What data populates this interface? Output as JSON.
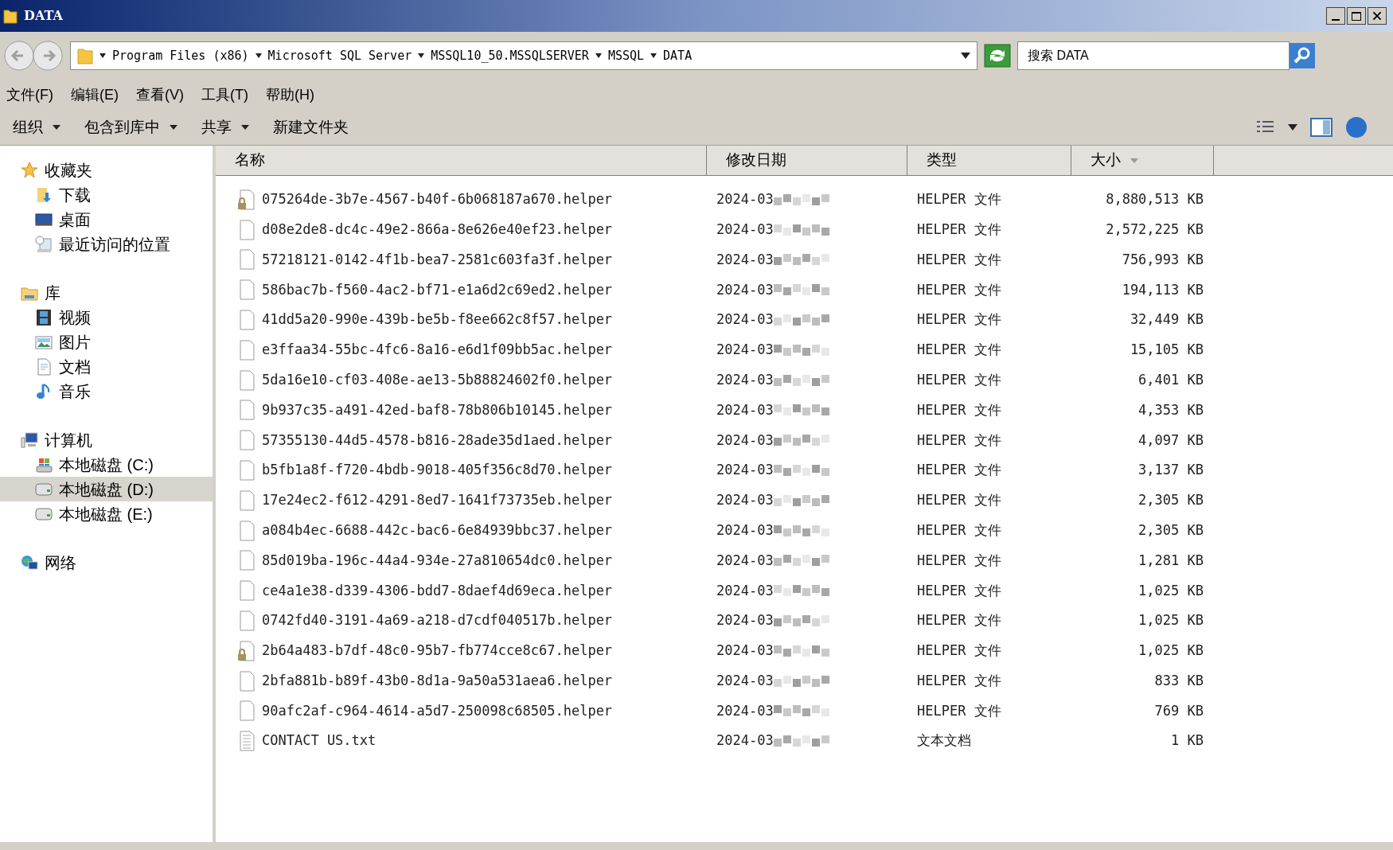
{
  "window": {
    "title": "DATA"
  },
  "address": {
    "segments": [
      "Program Files (x86)",
      "Microsoft SQL Server",
      "MSSQL10_50.MSSQLSERVER",
      "MSSQL",
      "DATA"
    ]
  },
  "search": {
    "placeholder": "搜索 DATA"
  },
  "menu": [
    "文件(F)",
    "编辑(E)",
    "查看(V)",
    "工具(T)",
    "帮助(H)"
  ],
  "toolbar": [
    {
      "label": "组织",
      "dropdown": true
    },
    {
      "label": "包含到库中",
      "dropdown": true
    },
    {
      "label": "共享",
      "dropdown": true
    },
    {
      "label": "新建文件夹",
      "dropdown": false
    }
  ],
  "sidebar": [
    {
      "label": "收藏夹",
      "children": [
        {
          "label": "下载",
          "selected": false
        },
        {
          "label": "桌面",
          "selected": false
        },
        {
          "label": "最近访问的位置",
          "selected": false
        }
      ]
    },
    {
      "label": "库",
      "children": [
        {
          "label": "视频",
          "selected": false
        },
        {
          "label": "图片",
          "selected": false
        },
        {
          "label": "文档",
          "selected": false
        },
        {
          "label": "音乐",
          "selected": false
        }
      ]
    },
    {
      "label": "计算机",
      "children": [
        {
          "label": "本地磁盘 (C:)",
          "selected": false
        },
        {
          "label": "本地磁盘 (D:)",
          "selected": true
        },
        {
          "label": "本地磁盘 (E:)",
          "selected": false
        }
      ]
    },
    {
      "label": "网络"
    }
  ],
  "columns": [
    {
      "label": "名称",
      "sorted": false
    },
    {
      "label": "修改日期",
      "sorted": false
    },
    {
      "label": "类型",
      "sorted": false
    },
    {
      "label": "大小",
      "sorted": true
    }
  ],
  "files": [
    {
      "name": "075264de-3b7e-4567-b40f-6b068187a670.helper",
      "kind": "file",
      "locked": true,
      "date": "2024-03",
      "type": "HELPER 文件",
      "size": "8,880,513 KB"
    },
    {
      "name": "d08e2de8-dc4c-49e2-866a-8e626e40ef23.helper",
      "kind": "file",
      "locked": false,
      "date": "2024-03",
      "type": "HELPER 文件",
      "size": "2,572,225 KB"
    },
    {
      "name": "57218121-0142-4f1b-bea7-2581c603fa3f.helper",
      "kind": "file",
      "locked": false,
      "date": "2024-03",
      "type": "HELPER 文件",
      "size": "756,993 KB"
    },
    {
      "name": "586bac7b-f560-4ac2-bf71-e1a6d2c69ed2.helper",
      "kind": "file",
      "locked": false,
      "date": "2024-03",
      "type": "HELPER 文件",
      "size": "194,113 KB"
    },
    {
      "name": "41dd5a20-990e-439b-be5b-f8ee662c8f57.helper",
      "kind": "file",
      "locked": false,
      "date": "2024-03",
      "type": "HELPER 文件",
      "size": "32,449 KB"
    },
    {
      "name": "e3ffaa34-55bc-4fc6-8a16-e6d1f09bb5ac.helper",
      "kind": "file",
      "locked": false,
      "date": "2024-03",
      "type": "HELPER 文件",
      "size": "15,105 KB"
    },
    {
      "name": "5da16e10-cf03-408e-ae13-5b88824602f0.helper",
      "kind": "file",
      "locked": false,
      "date": "2024-03",
      "type": "HELPER 文件",
      "size": "6,401 KB"
    },
    {
      "name": "9b937c35-a491-42ed-baf8-78b806b10145.helper",
      "kind": "file",
      "locked": false,
      "date": "2024-03",
      "type": "HELPER 文件",
      "size": "4,353 KB"
    },
    {
      "name": "57355130-44d5-4578-b816-28ade35d1aed.helper",
      "kind": "file",
      "locked": false,
      "date": "2024-03",
      "type": "HELPER 文件",
      "size": "4,097 KB"
    },
    {
      "name": "b5fb1a8f-f720-4bdb-9018-405f356c8d70.helper",
      "kind": "file",
      "locked": false,
      "date": "2024-03",
      "type": "HELPER 文件",
      "size": "3,137 KB"
    },
    {
      "name": "17e24ec2-f612-4291-8ed7-1641f73735eb.helper",
      "kind": "file",
      "locked": false,
      "date": "2024-03",
      "type": "HELPER 文件",
      "size": "2,305 KB"
    },
    {
      "name": "a084b4ec-6688-442c-bac6-6e84939bbc37.helper",
      "kind": "file",
      "locked": false,
      "date": "2024-03",
      "type": "HELPER 文件",
      "size": "2,305 KB"
    },
    {
      "name": "85d019ba-196c-44a4-934e-27a810654dc0.helper",
      "kind": "file",
      "locked": false,
      "date": "2024-03",
      "type": "HELPER 文件",
      "size": "1,281 KB"
    },
    {
      "name": "ce4a1e38-d339-4306-bdd7-8daef4d69eca.helper",
      "kind": "file",
      "locked": false,
      "date": "2024-03",
      "type": "HELPER 文件",
      "size": "1,025 KB"
    },
    {
      "name": "0742fd40-3191-4a69-a218-d7cdf040517b.helper",
      "kind": "file",
      "locked": false,
      "date": "2024-03",
      "type": "HELPER 文件",
      "size": "1,025 KB"
    },
    {
      "name": "2b64a483-b7df-48c0-95b7-fb774cce8c67.helper",
      "kind": "file",
      "locked": true,
      "date": "2024-03",
      "type": "HELPER 文件",
      "size": "1,025 KB"
    },
    {
      "name": "2bfa881b-b89f-43b0-8d1a-9a50a531aea6.helper",
      "kind": "file",
      "locked": false,
      "date": "2024-03",
      "type": "HELPER 文件",
      "size": "833 KB"
    },
    {
      "name": "90afc2af-c964-4614-a5d7-250098c68505.helper",
      "kind": "file",
      "locked": false,
      "date": "2024-03",
      "type": "HELPER 文件",
      "size": "769 KB"
    },
    {
      "name": "CONTACT US.txt",
      "kind": "text",
      "locked": false,
      "date": "2024-03",
      "type": "文本文档",
      "size": "1 KB"
    }
  ]
}
